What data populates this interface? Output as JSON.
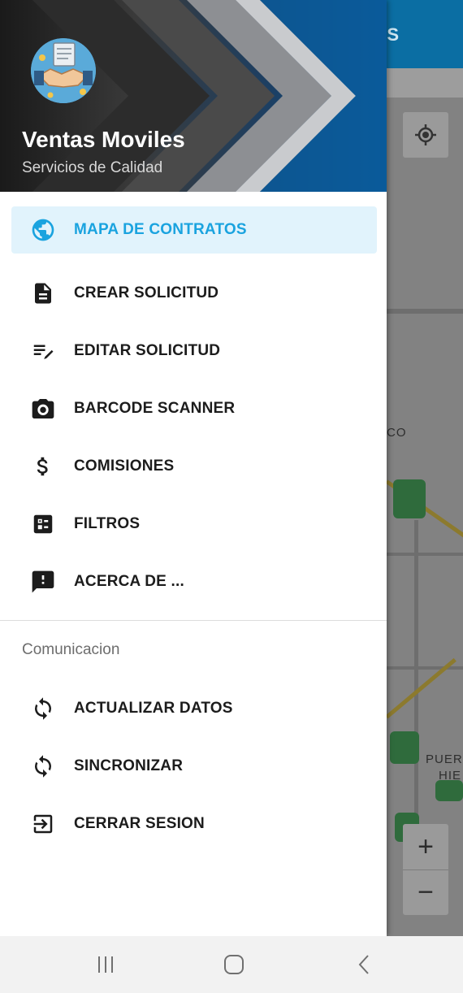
{
  "drawer": {
    "title": "Ventas Moviles",
    "subtitle": "Servicios de Calidad",
    "accent_color": "#1aa3df",
    "active_bg": "#e1f3fc",
    "main_items": [
      {
        "label": "MAPA DE CONTRATOS",
        "icon": "globe-icon",
        "active": true
      },
      {
        "label": "CREAR SOLICITUD",
        "icon": "document-icon",
        "active": false
      },
      {
        "label": "EDITAR SOLICITUD",
        "icon": "edit-list-icon",
        "active": false
      },
      {
        "label": "BARCODE SCANNER",
        "icon": "camera-icon",
        "active": false
      },
      {
        "label": "COMISIONES",
        "icon": "dollar-icon",
        "active": false
      },
      {
        "label": "FILTROS",
        "icon": "list-alt-icon",
        "active": false
      },
      {
        "label": "ACERCA DE ...",
        "icon": "feedback-icon",
        "active": false
      }
    ],
    "section": {
      "title": "Comunicacion",
      "items": [
        {
          "label": "ACTUALIZAR DATOS",
          "icon": "sync-icon"
        },
        {
          "label": "SINCRONIZAR",
          "icon": "sync-icon"
        },
        {
          "label": "CERRAR SESION",
          "icon": "exit-icon"
        }
      ]
    }
  },
  "background_map": {
    "appbar_title_fragment": "S",
    "labels": [
      "CO",
      "PUER",
      "HIE"
    ],
    "zoom_in_label": "+",
    "zoom_out_label": "−"
  }
}
